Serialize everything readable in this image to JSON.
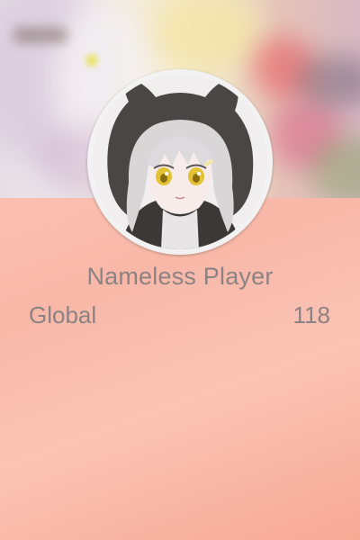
{
  "profile": {
    "player_name": "Nameless Player",
    "region_label": "Global",
    "rank_value": "118",
    "avatar": "anime-girl-hood-avatar",
    "banner": "blurred-anime-banner"
  },
  "colors": {
    "background_accent": "#f9b3a5",
    "text": "#8c8284",
    "avatar_ring": "#f2f2f2"
  }
}
